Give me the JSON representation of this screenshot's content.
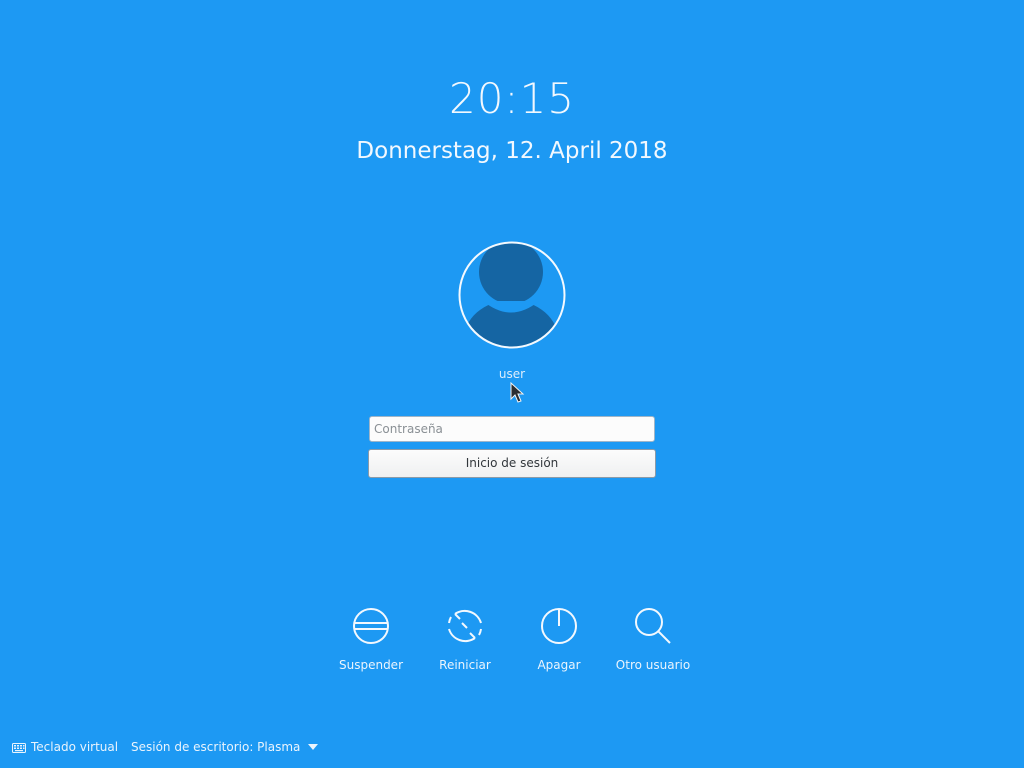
{
  "clock": {
    "time": "20:15",
    "date": "Donnerstag, 12. April 2018"
  },
  "user": {
    "name": "user",
    "avatar_icon": "user-silhouette-icon"
  },
  "login": {
    "password_placeholder": "Contraseña",
    "password_value": "",
    "submit_label": "Inicio de sesión"
  },
  "actions": [
    {
      "label": "Suspender",
      "icon": "suspend-icon"
    },
    {
      "label": "Reiniciar",
      "icon": "restart-icon"
    },
    {
      "label": "Apagar",
      "icon": "power-icon"
    },
    {
      "label": "Otro usuario",
      "icon": "search-icon"
    }
  ],
  "bottom_bar": {
    "virtual_keyboard_label": "Teclado virtual",
    "session_label": "Sesión de escritorio: Plasma"
  },
  "colors": {
    "background": "#1d99f3",
    "avatar_fill": "#1565a3",
    "text": "#eaf4fd"
  }
}
